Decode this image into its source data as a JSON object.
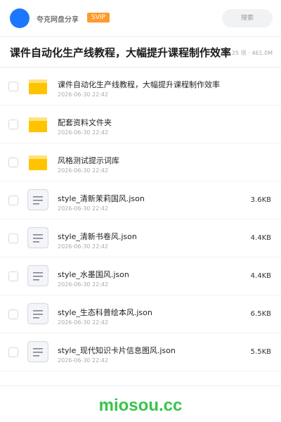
{
  "header": {
    "share_name": "夸克网盘分享",
    "badge": "SVIP",
    "search_label": "搜索"
  },
  "folder": {
    "title": "课件自动化生产线教程，大幅提升课程制作效率",
    "meta": "25 项 · 461.0M"
  },
  "colors": {
    "accent": "#1c77ff",
    "badge": "#ff9a2e",
    "folder": "#ffc400",
    "watermark": "#37c44a"
  },
  "files": [
    {
      "type": "folder",
      "icon": "folder-icon",
      "name": "课件自动化生产线教程，大幅提升课程制作效率",
      "date": "2026-06-30 22:42",
      "size": ""
    },
    {
      "type": "folder",
      "icon": "folder-icon",
      "name": "配套资料文件夹",
      "date": "2026-06-30 22:42",
      "size": ""
    },
    {
      "type": "folder",
      "icon": "folder-icon",
      "name": "风格测试提示词库",
      "date": "2026-06-30 22:42",
      "size": ""
    },
    {
      "type": "file",
      "icon": "document-icon",
      "name": "style_清新茉莉国风.json",
      "date": "2026-06-30 22:42",
      "size": "3.6KB"
    },
    {
      "type": "file",
      "icon": "document-icon",
      "name": "style_清新书卷风.json",
      "date": "2026-06-30 22:42",
      "size": "4.4KB"
    },
    {
      "type": "file",
      "icon": "document-icon",
      "name": "style_水墨国风.json",
      "date": "2026-06-30 22:42",
      "size": "4.4KB"
    },
    {
      "type": "file",
      "icon": "document-icon",
      "name": "style_生态科普绘本风.json",
      "date": "2026-06-30 22:42",
      "size": "6.5KB"
    },
    {
      "type": "file",
      "icon": "document-icon",
      "name": "style_现代知识卡片信息图风.json",
      "date": "2026-06-30 22:42",
      "size": "5.5KB"
    }
  ],
  "footer": {
    "watermark": "miosou.cc"
  }
}
